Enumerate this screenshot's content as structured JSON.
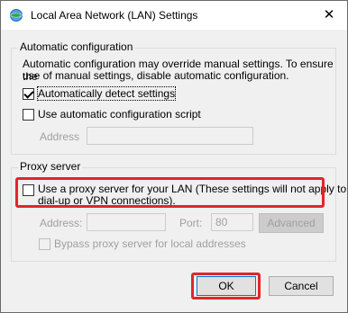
{
  "window": {
    "title": "Local Area Network (LAN) Settings",
    "close_glyph": "✕"
  },
  "auto_config": {
    "group_title": "Automatic configuration",
    "description_line1": "Automatic configuration may override manual settings.  To ensure the",
    "description_line2": "use of manual settings, disable automatic configuration.",
    "auto_detect": {
      "label": "Automatically detect settings",
      "checked": true
    },
    "use_script": {
      "label": "Use automatic configuration script",
      "checked": false
    },
    "address_label": "Address",
    "address_value": ""
  },
  "proxy": {
    "group_title": "Proxy server",
    "use_proxy_line1": "Use a proxy server for your LAN (These settings will not apply to",
    "use_proxy_line2": "dial-up or VPN connections).",
    "use_proxy_checked": false,
    "address_label": "Address:",
    "address_value": "",
    "port_label": "Port:",
    "port_value": "80",
    "advanced_label": "Advanced",
    "bypass_label": "Bypass proxy server for local addresses",
    "bypass_checked": false
  },
  "buttons": {
    "ok": "OK",
    "cancel": "Cancel"
  },
  "colors": {
    "highlight": "#e0262a",
    "default_button_border": "#0078d7"
  },
  "icons": {
    "title": "internet-options-globe-icon",
    "close": "close-icon"
  }
}
